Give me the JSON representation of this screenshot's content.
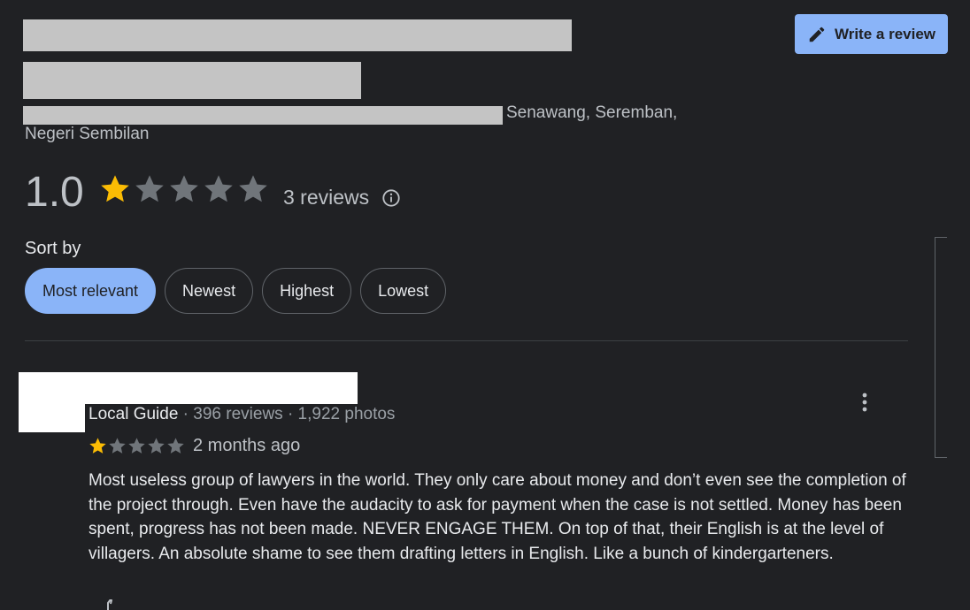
{
  "place": {
    "address_tail": "Senawang, Seremban,",
    "address_line2": "Negeri Sembilan"
  },
  "actions": {
    "write_review_label": "Write a review"
  },
  "summary": {
    "rating": "1.0",
    "rating_value": 1,
    "rating_max": 5,
    "reviews_count": "3 reviews"
  },
  "sort": {
    "label": "Sort by",
    "options": [
      "Most relevant",
      "Newest",
      "Highest",
      "Lowest"
    ],
    "selected": "Most relevant"
  },
  "review": {
    "guide_label": "Local Guide",
    "stats": " · 396 reviews · 1,922 photos",
    "rating_value": 1,
    "date": "2 months ago",
    "text": "Most useless group of lawyers in the world. They only care about money and don’t even see the completion of the project through. Even have the audacity to ask for payment when the case is not settled. Money has been spent, progress has not been made. NEVER ENGAGE THEM. On top of that, their English is at the level of villagers. An absolute shame to see them drafting letters in English. Like a bunch of kindergarteners."
  },
  "colors": {
    "background": "#202124",
    "accent": "#8ab4f8",
    "star_filled": "#fbbc04",
    "star_empty": "#70757a"
  },
  "icons": {
    "write_review": "pencil-icon",
    "info": "info-icon",
    "more": "more-vert-icon",
    "like": "thumbs-up-icon"
  }
}
